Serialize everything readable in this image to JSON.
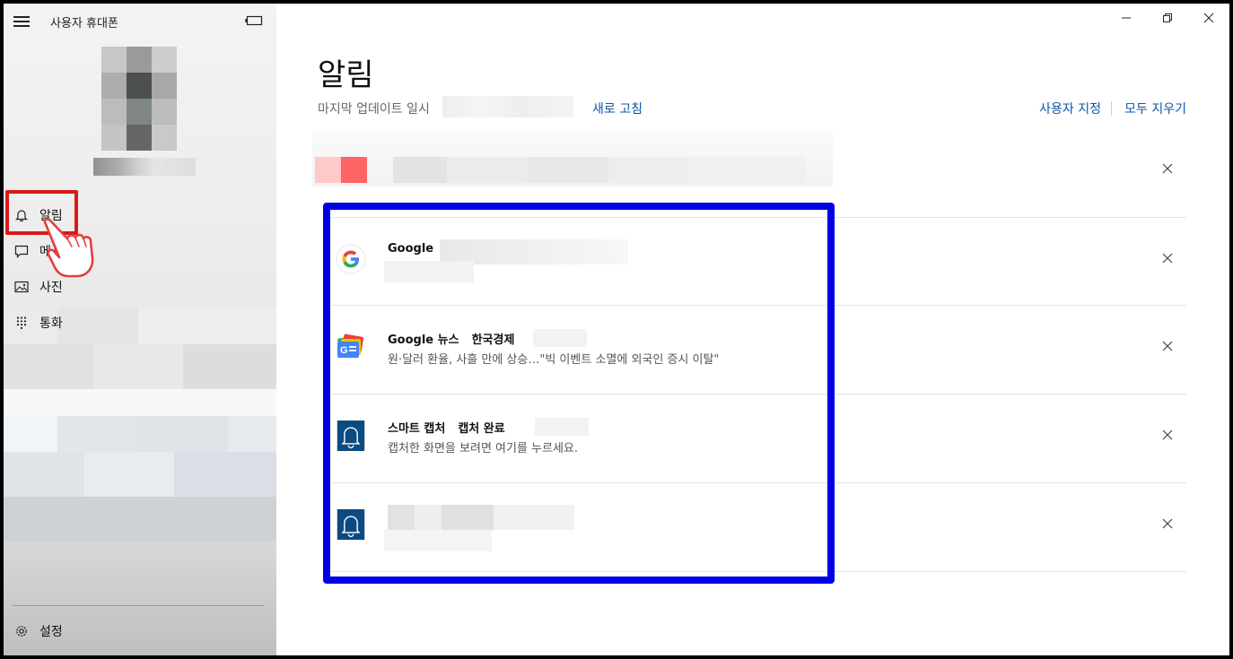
{
  "app": {
    "title": "사용자 휴대폰"
  },
  "sidebar": {
    "items": [
      {
        "label": "알림",
        "icon": "bell-icon"
      },
      {
        "label": "메시지",
        "icon": "message-icon"
      },
      {
        "label": "사진",
        "icon": "photo-icon"
      },
      {
        "label": "통화",
        "icon": "dialpad-icon"
      }
    ],
    "settings_label": "설정"
  },
  "main": {
    "title": "알림",
    "last_update_label": "마지막 업데이트 일시",
    "refresh_label": "새로 고침",
    "customize_label": "사용자 지정",
    "clear_all_label": "모두 지우기"
  },
  "notifications": [
    {
      "app": "Google",
      "title": "",
      "body": "",
      "icon": "google-icon"
    },
    {
      "app": "Google 뉴스",
      "title": "한국경제",
      "body": "원·달러 환율, 사흘 만에 상승…\"빅 이벤트 소멸에 외국인 증시 이탈\"",
      "icon": "google-news-icon"
    },
    {
      "app": "스마트 캡처",
      "title": "캡처 완료",
      "body": "캡처한 화면을 보려면 여기를 누르세요.",
      "icon": "bell-icon"
    },
    {
      "app": "",
      "title": "",
      "body": "",
      "icon": "bell-icon"
    }
  ],
  "colors": {
    "accent_link": "#0a56a8",
    "annotation_red": "#d91a1a",
    "annotation_blue": "#0000e6",
    "notification_icon_bg": "#0c4a82"
  }
}
